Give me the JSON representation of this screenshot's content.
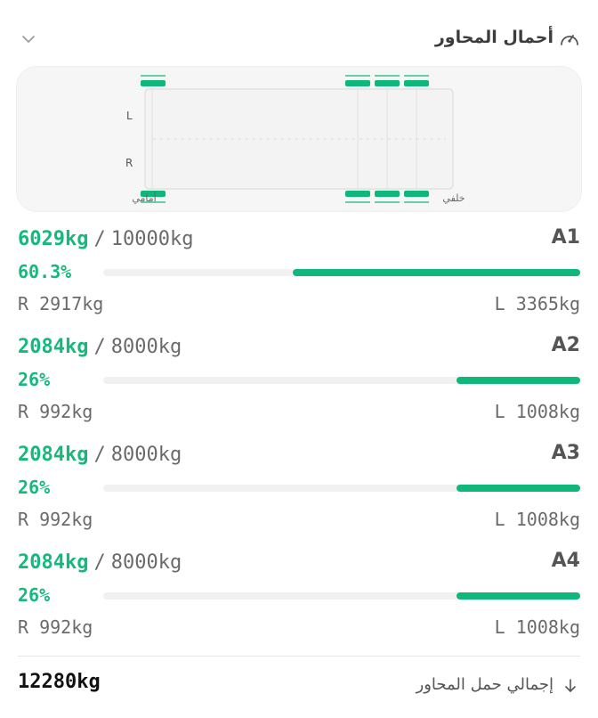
{
  "header": {
    "title": "أحمال المحاور",
    "gauge_icon": "speedometer-icon",
    "chevron_icon": "chevron-down-icon"
  },
  "diagram": {
    "labels": {
      "left_side": "L",
      "right_side": "R",
      "front": "أمامي",
      "rear": "خلفي"
    },
    "accent_color": "#10b77a"
  },
  "axles": [
    {
      "name": "A1",
      "current": "6029kg",
      "max": "10000kg",
      "percent_label": "60.3%",
      "fraction": 0.603,
      "right": "R 2917kg",
      "left": "L 3365kg"
    },
    {
      "name": "A2",
      "current": "2084kg",
      "max": "8000kg",
      "percent_label": "26%",
      "fraction": 0.26,
      "right": "R 992kg",
      "left": "L 1008kg"
    },
    {
      "name": "A3",
      "current": "2084kg",
      "max": "8000kg",
      "percent_label": "26%",
      "fraction": 0.26,
      "right": "R 992kg",
      "left": "L 1008kg"
    },
    {
      "name": "A4",
      "current": "2084kg",
      "max": "8000kg",
      "percent_label": "26%",
      "fraction": 0.26,
      "right": "R 992kg",
      "left": "L 1008kg"
    }
  ],
  "separator": "/",
  "total": {
    "label": "إجمالي حمل المحاور",
    "value": "12280kg",
    "arrow_icon": "arrow-down-icon"
  }
}
